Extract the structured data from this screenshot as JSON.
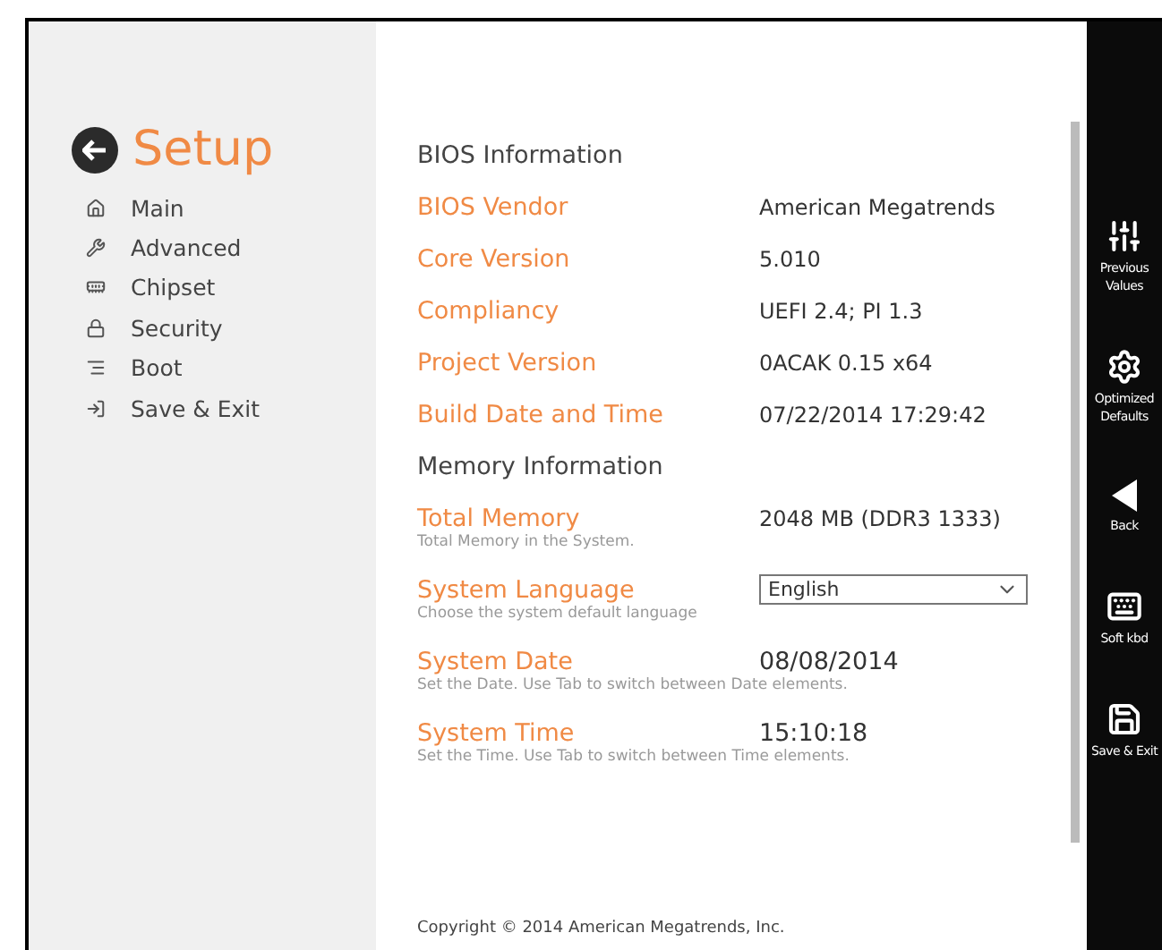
{
  "sidebar": {
    "title": "Setup",
    "items": [
      {
        "label": "Main"
      },
      {
        "label": "Advanced"
      },
      {
        "label": "Chipset"
      },
      {
        "label": "Security"
      },
      {
        "label": "Boot"
      },
      {
        "label": "Save & Exit"
      }
    ]
  },
  "content": {
    "rows": [
      {
        "kind": "heading",
        "label": "BIOS Information"
      },
      {
        "kind": "info",
        "label": "BIOS Vendor",
        "value": "American Megatrends"
      },
      {
        "kind": "info",
        "label": "Core Version",
        "value": "5.010"
      },
      {
        "kind": "info",
        "label": "Compliancy",
        "value": "UEFI 2.4; PI 1.3"
      },
      {
        "kind": "info",
        "label": "Project Version",
        "value": "0ACAK 0.15 x64"
      },
      {
        "kind": "info",
        "label": "Build Date and Time",
        "value": "07/22/2014 17:29:42"
      },
      {
        "kind": "heading",
        "label": "Memory Information"
      },
      {
        "kind": "info",
        "label": "Total Memory",
        "value": "2048 MB (DDR3 1333)",
        "help": "Total Memory in the System."
      },
      {
        "kind": "dropdown",
        "label": "System Language",
        "value": "English",
        "help": "Choose the system default language"
      },
      {
        "kind": "setting",
        "label": "System Date",
        "value": "08/08/2014",
        "help": "Set the Date. Use Tab to switch between Date elements."
      },
      {
        "kind": "setting",
        "label": "System Time",
        "value": "15:10:18",
        "help": "Set the Time. Use Tab to switch between Time elements."
      }
    ],
    "copyright": "Copyright © 2014 American Megatrends, Inc."
  },
  "toolbar": [
    {
      "label": "Previous Values"
    },
    {
      "label": "Optimized Defaults"
    },
    {
      "label": "Back"
    },
    {
      "label": "Soft kbd"
    },
    {
      "label": "Save & Exit"
    }
  ]
}
